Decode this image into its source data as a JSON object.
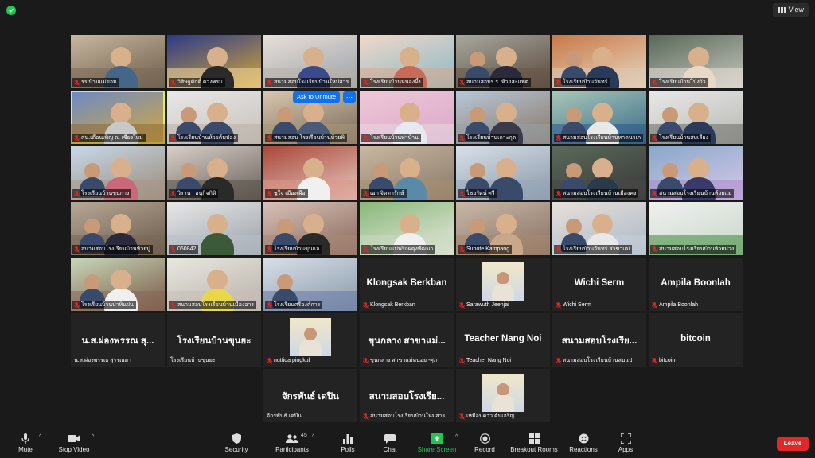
{
  "window": {
    "view_label": "View"
  },
  "popup": {
    "unmute_label": "Ask to Unmute",
    "more_label": "…"
  },
  "participants": [
    {
      "name": "รร.บ้านแม่ยอม",
      "muted": true
    },
    {
      "name": "วิสิษฐศักดิ์ ดวงพรม",
      "muted": true
    },
    {
      "name": "สนามสอบโรงเรียนบ้านใหม่สาร",
      "muted": true
    },
    {
      "name": "โรงเรียนบ้านหนองผึ้ง",
      "muted": true
    },
    {
      "name": "สนามสอบร.ร. ห้วยสะแพด",
      "muted": true
    },
    {
      "name": "โรงเรียนบ้านจันทร์",
      "muted": true
    },
    {
      "name": "โรงเรียนบ้านโป่งวัว",
      "muted": true
    },
    {
      "name": "ศน.เดือนเพ็ญ ณ เชียงใหม่",
      "muted": true
    },
    {
      "name": "โรงเรียนบ้านห้วยต้มป่อง",
      "muted": true
    },
    {
      "name": "สนามสอบ โรงเรียนบ้านห้วยพิ",
      "muted": true
    },
    {
      "name": "โรงเรียนบ้านท่าบ้าน",
      "muted": true
    },
    {
      "name": "โรงเรียนบ้านเกาะกุด",
      "muted": true
    },
    {
      "name": "สนามสอบโรงเรียนบ้านหาดนาเก",
      "muted": true
    },
    {
      "name": "โรงเรียนบ้านสบเลียง",
      "muted": true
    },
    {
      "name": "โรงเรียนบ้านขุนกาง",
      "muted": true
    },
    {
      "name": "วิรานา อนุกิจกิติ",
      "muted": true
    },
    {
      "name": "ชูใจ เมืองเผือ",
      "muted": true
    },
    {
      "name": "เอก จิตตารักษ์",
      "muted": true
    },
    {
      "name": "ไชยรัตน์ ศรี",
      "muted": true
    },
    {
      "name": "สนามสอบโรงเรียนบ้านเมืองคง",
      "muted": true
    },
    {
      "name": "สนามสอบโรงเรียนบ้านห้วยแม่",
      "muted": true
    },
    {
      "name": "สนามสอบโรงเรียนบ้านห้วยปู",
      "muted": true
    },
    {
      "name": "060842",
      "muted": true
    },
    {
      "name": "โรงเรียนบ้านขุนแจ",
      "muted": true
    },
    {
      "name": "โรงเรียนแม่พริกผดุงพัฒนา",
      "muted": true
    },
    {
      "name": "Supote Kampang",
      "muted": true
    },
    {
      "name": "โรงเรียนบ้านจันทร์ สาขาแม่",
      "muted": true
    },
    {
      "name": "สนามสอบโรงเรียนบ้านห้วยม่วง",
      "muted": true
    },
    {
      "name": "โรงเรียนบ้านป่าหินฝน",
      "muted": true
    },
    {
      "name": "สนามสอบโรงเรียนบ้านเมืองอาง",
      "muted": true
    },
    {
      "name": "โรงเรียนศรีองค์การ",
      "muted": true
    },
    {
      "name": "Klongsak Berkban",
      "display": "Klongsak Berkban",
      "muted": true
    },
    {
      "name": "Sarawuth Jeenjai",
      "muted": true
    },
    {
      "name": "Wichi Serm",
      "display": "Wichi Serm",
      "muted": true
    },
    {
      "name": "Ampila Boonlah",
      "display": "Ampila Boonlah",
      "muted": true
    },
    {
      "name": "น.ส.ผ่องพรรณ สุรรณมา",
      "display": "น.ส.ผ่องพรรณ สุ...",
      "muted": false
    },
    {
      "name": "โรงเรียนบ้านขุนยะ",
      "display": "โรงเรียนบ้านขุนยะ",
      "muted": false
    },
    {
      "name": "nuttida pingkul",
      "muted": true
    },
    {
      "name": "ขุนกลาง สาขาแม่หนอย -ศุภ",
      "display": "ขุนกลาง สาขาแม่...",
      "muted": true
    },
    {
      "name": "Teacher Nang Noi",
      "display": "Teacher Nang Noi",
      "muted": true
    },
    {
      "name": "สนามสอบโรงเรียนบ้านสบแป",
      "display": "สนามสอบโรงเรีย...",
      "muted": true
    },
    {
      "name": "bitcoin",
      "display": "bitcoin",
      "muted": true
    },
    {
      "name": "จักรพันธ์ เดปิน",
      "display": "จักรพันธ์ เดปิน",
      "muted": false
    },
    {
      "name": "สนามสอบโรงเรียนบ้านใหม่สาร",
      "display": "สนามสอบโรงเรีย...",
      "muted": true
    },
    {
      "name": "เหมือนดาว ต้นเจริญ",
      "muted": true
    }
  ],
  "toolbar": {
    "mute": "Mute",
    "stop_video": "Stop Video",
    "security": "Security",
    "participants": "Participants",
    "participants_count": "45",
    "polls": "Polls",
    "chat": "Chat",
    "share_screen": "Share Screen",
    "record": "Record",
    "breakout_rooms": "Breakout Rooms",
    "reactions": "Reactions",
    "apps": "Apps",
    "leave": "Leave"
  },
  "colors": {
    "accent_green": "#23c552",
    "leave_red": "#e02828",
    "speaker_border": "#e6f23a",
    "popup_blue": "#0e72ed"
  }
}
